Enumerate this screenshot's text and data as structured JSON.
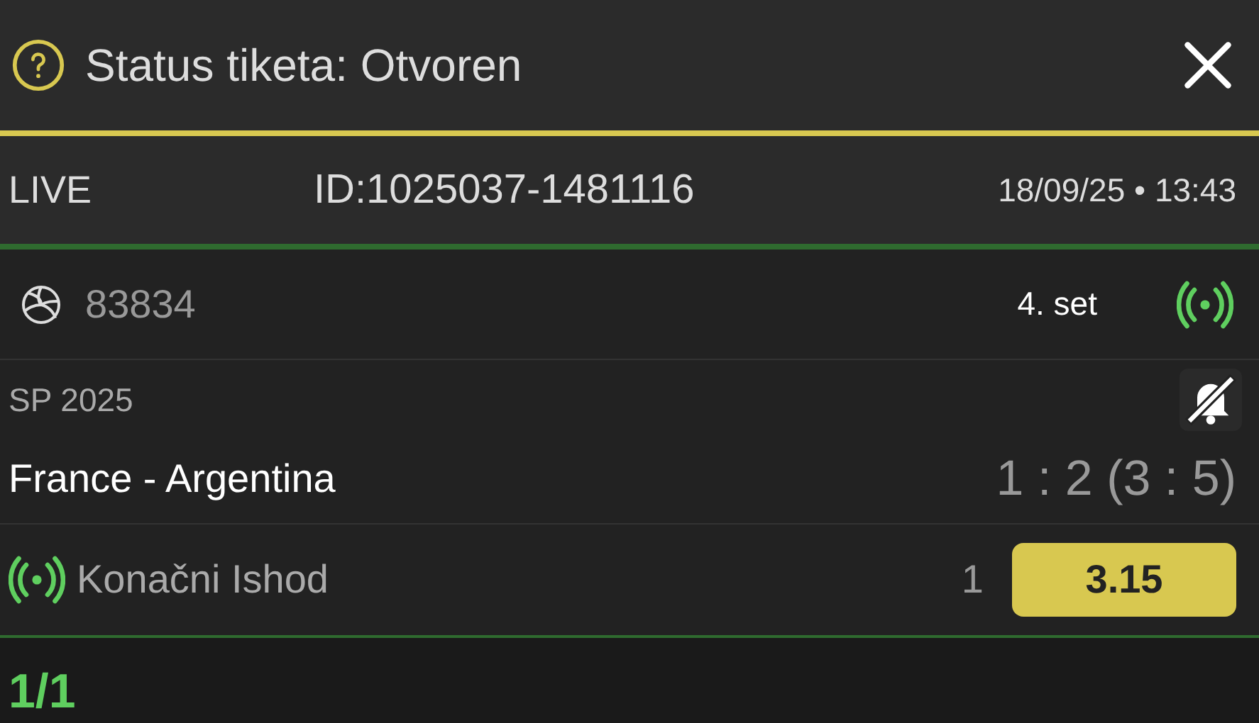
{
  "header": {
    "title": "Status tiketa: Otvoren"
  },
  "ticket": {
    "mode": "LIVE",
    "id": "ID:1025037-1481116",
    "datetime": "18/09/25 • 13:43"
  },
  "event": {
    "code": "83834",
    "period": "4. set",
    "live": true,
    "league": "SP 2025",
    "match": "France - Argentina",
    "score": "1 : 2 (3 : 5)",
    "notifications": false
  },
  "bet": {
    "live": true,
    "market": "Konačni Ishod",
    "pick": "1",
    "odds": "3.15",
    "selected": true
  },
  "footer": {
    "count": "1/1"
  }
}
